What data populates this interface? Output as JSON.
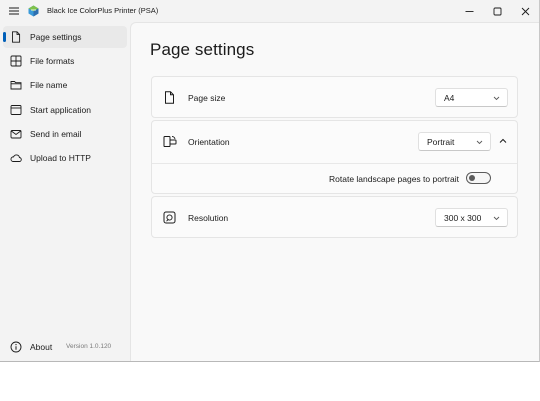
{
  "window": {
    "title": "Black Ice ColorPlus Printer (PSA)",
    "accent_color": "#005fb8",
    "controls": [
      "minimize",
      "maximize",
      "close"
    ]
  },
  "sidebar": {
    "items": [
      {
        "label": "Page settings",
        "icon": "page-icon",
        "active": true
      },
      {
        "label": "File formats",
        "icon": "grid-icon",
        "active": false
      },
      {
        "label": "File name",
        "icon": "folder-icon",
        "active": false
      },
      {
        "label": "Start application",
        "icon": "window-icon",
        "active": false
      },
      {
        "label": "Send in email",
        "icon": "mail-icon",
        "active": false
      },
      {
        "label": "Upload to HTTP",
        "icon": "cloud-icon",
        "active": false
      }
    ],
    "about": {
      "label": "About",
      "icon": "info-icon",
      "version": "Version 1.0.120"
    }
  },
  "main": {
    "title": "Page settings",
    "page_size": {
      "label": "Page size",
      "icon": "page-icon",
      "value": "A4"
    },
    "orientation": {
      "label": "Orientation",
      "icon": "orientation-icon",
      "value": "Portrait",
      "expanded": true,
      "rotate_landscape": {
        "label": "Rotate landscape pages to portrait",
        "on": false
      }
    },
    "resolution": {
      "label": "Resolution",
      "icon": "resolution-icon",
      "value": "300 x 300"
    }
  }
}
